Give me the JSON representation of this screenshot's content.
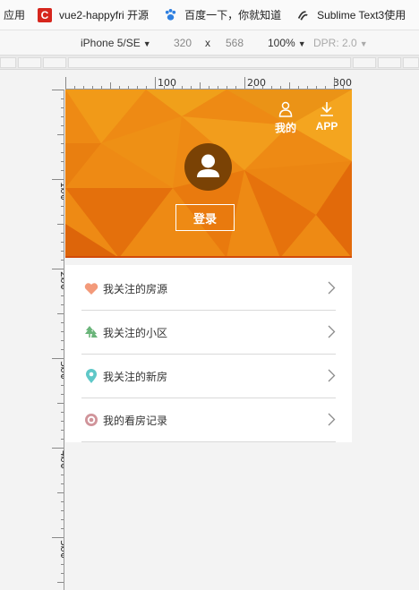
{
  "browser": {
    "bookmarks": [
      {
        "label": "应用",
        "icon": "apps-icon"
      },
      {
        "label": "vue2-happyfri 开源",
        "icon": "csdn-c-icon"
      },
      {
        "label": "百度一下，你就知道",
        "icon": "baidu-paw-icon"
      },
      {
        "label": "Sublime Text3使用",
        "icon": "sublime-icon"
      }
    ]
  },
  "devtools": {
    "device": "iPhone 5/SE",
    "width": "320",
    "times": "x",
    "height": "568",
    "zoom": "100%",
    "dpr": "DPR: 2.0"
  },
  "rulers": {
    "horizontal": [
      "100",
      "200",
      "300"
    ],
    "vertical": [
      "100",
      "200",
      "300",
      "400",
      "500"
    ]
  },
  "header": {
    "mine_label": "我的",
    "app_label": "APP",
    "login_label": "登录",
    "colors": {
      "primary": "#ef8a12",
      "accent_line": "#d24b0a",
      "avatar": "#7a4205"
    }
  },
  "menu": {
    "items": [
      {
        "label": "我关注的房源",
        "icon": "heart-icon",
        "color": "#f39a7a"
      },
      {
        "label": "我关注的小区",
        "icon": "tree-icon",
        "color": "#6ab57a"
      },
      {
        "label": "我关注的新房",
        "icon": "location-pin-icon",
        "color": "#5fc8c8"
      },
      {
        "label": "我的看房记录",
        "icon": "eye-icon",
        "color": "#d0949a"
      }
    ]
  }
}
